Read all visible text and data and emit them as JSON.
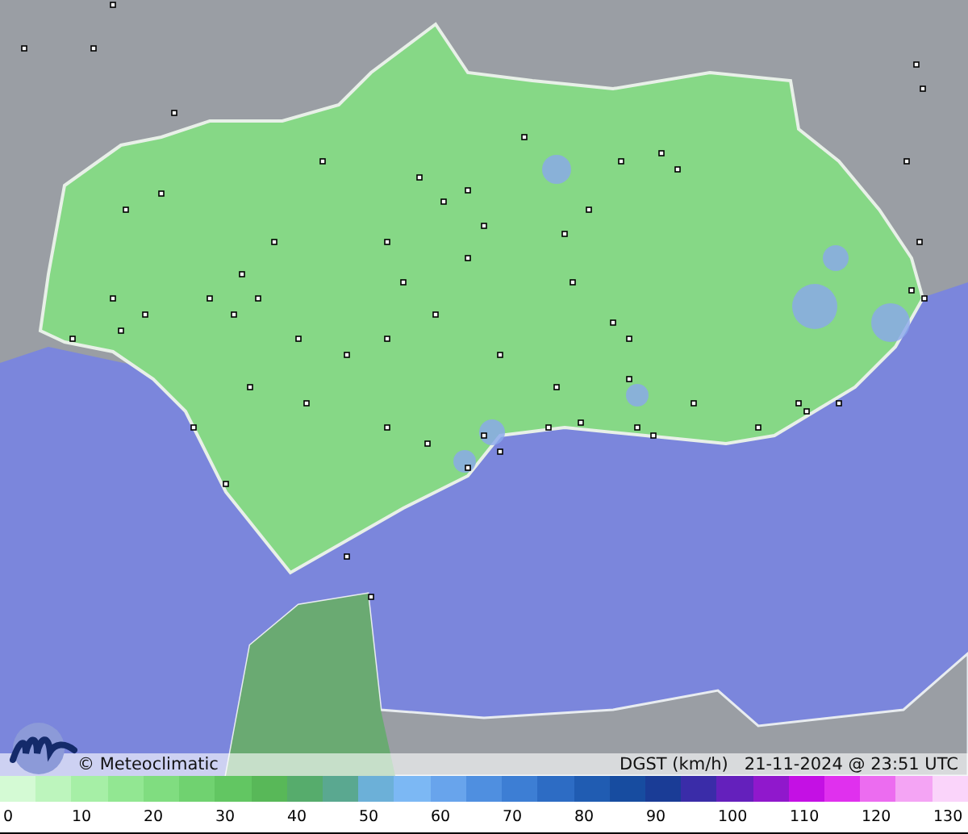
{
  "map": {
    "credit": "© Meteoclimatic",
    "variable": "DGST (km/h)",
    "timestamp": "21-11-2024 @ 23:51 UTC"
  },
  "legend": {
    "swatches": [
      {
        "color": "#d4fad4"
      },
      {
        "color": "#bdf5bd"
      },
      {
        "color": "#a6efa6"
      },
      {
        "color": "#92e792"
      },
      {
        "color": "#80dd80"
      },
      {
        "color": "#70d270"
      },
      {
        "color": "#62c662"
      },
      {
        "color": "#58b858"
      },
      {
        "color": "#56ac6c"
      },
      {
        "color": "#5aa890"
      },
      {
        "color": "#6cb0d8"
      },
      {
        "color": "#7cb8f4"
      },
      {
        "color": "#68a4ec"
      },
      {
        "color": "#4f8fe0"
      },
      {
        "color": "#3d7ed4"
      },
      {
        "color": "#2d6cc4"
      },
      {
        "color": "#205cb2"
      },
      {
        "color": "#174ca0"
      },
      {
        "color": "#1a3c96"
      },
      {
        "color": "#3a2ca8"
      },
      {
        "color": "#6420bc"
      },
      {
        "color": "#9018cc"
      },
      {
        "color": "#c410e4"
      },
      {
        "color": "#e030ee"
      },
      {
        "color": "#ec6cf0"
      },
      {
        "color": "#f4a4f4"
      },
      {
        "color": "#fad4fa"
      }
    ],
    "ticks": [
      "0",
      "10",
      "20",
      "30",
      "40",
      "50",
      "60",
      "70",
      "80",
      "90",
      "100",
      "110",
      "120",
      "130"
    ]
  }
}
